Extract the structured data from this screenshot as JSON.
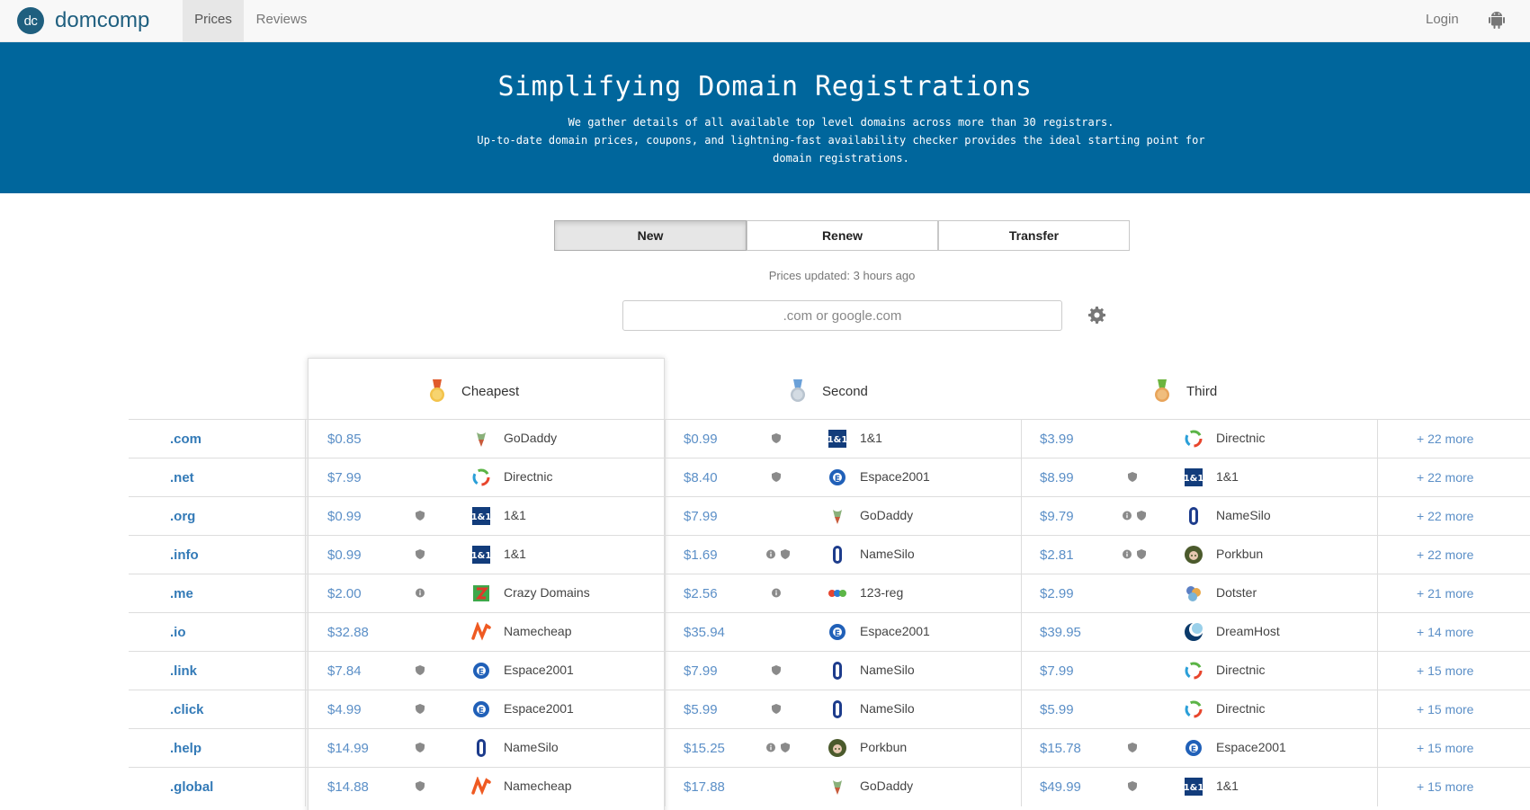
{
  "nav": {
    "logo": "dc",
    "brand": "domcomp",
    "tabs": [
      "Prices",
      "Reviews"
    ],
    "login": "Login"
  },
  "hero": {
    "title": "Simplifying Domain Registrations",
    "line1": "We gather details of all available top level domains across more than 30 registrars.",
    "line2": "Up-to-date domain prices, coupons, and lightning-fast availability checker provides the ideal starting point for domain registrations."
  },
  "toggle": {
    "new": "New",
    "renew": "Renew",
    "transfer": "Transfer",
    "selected": "New"
  },
  "updated": "Prices updated: 3 hours ago",
  "search": {
    "placeholder": ".com or google.com"
  },
  "headers": {
    "cheapest": "Cheapest",
    "second": "Second",
    "third": "Third"
  },
  "colors": {
    "hero": "#00669c",
    "link": "#337ab7",
    "price": "#5b8fc7"
  },
  "rows": [
    {
      "tld": ".com",
      "c": [
        "$0.85",
        [],
        "GoDaddy",
        "godaddy"
      ],
      "s": [
        "$0.99",
        [
          "shield"
        ],
        "1&1",
        "oneandone"
      ],
      "t": [
        "$3.99",
        [],
        "Directnic",
        "directnic"
      ],
      "more": "+ 22 more"
    },
    {
      "tld": ".net",
      "c": [
        "$7.99",
        [],
        "Directnic",
        "directnic"
      ],
      "s": [
        "$8.40",
        [
          "shield"
        ],
        "Espace2001",
        "espace"
      ],
      "t": [
        "$8.99",
        [
          "shield"
        ],
        "1&1",
        "oneandone"
      ],
      "more": "+ 22 more"
    },
    {
      "tld": ".org",
      "c": [
        "$0.99",
        [
          "shield"
        ],
        "1&1",
        "oneandone"
      ],
      "s": [
        "$7.99",
        [],
        "GoDaddy",
        "godaddy"
      ],
      "t": [
        "$9.79",
        [
          "info",
          "shield"
        ],
        "NameSilo",
        "namesilo"
      ],
      "more": "+ 22 more"
    },
    {
      "tld": ".info",
      "c": [
        "$0.99",
        [
          "shield"
        ],
        "1&1",
        "oneandone"
      ],
      "s": [
        "$1.69",
        [
          "info",
          "shield"
        ],
        "NameSilo",
        "namesilo"
      ],
      "t": [
        "$2.81",
        [
          "info",
          "shield"
        ],
        "Porkbun",
        "porkbun"
      ],
      "more": "+ 22 more"
    },
    {
      "tld": ".me",
      "c": [
        "$2.00",
        [
          "info"
        ],
        "Crazy Domains",
        "crazy"
      ],
      "s": [
        "$2.56",
        [
          "info"
        ],
        "123-reg",
        "reg123"
      ],
      "t": [
        "$2.99",
        [],
        "Dotster",
        "dotster"
      ],
      "more": "+ 21 more"
    },
    {
      "tld": ".io",
      "c": [
        "$32.88",
        [],
        "Namecheap",
        "namecheap"
      ],
      "s": [
        "$35.94",
        [],
        "Espace2001",
        "espace"
      ],
      "t": [
        "$39.95",
        [],
        "DreamHost",
        "dreamhost"
      ],
      "more": "+ 14 more"
    },
    {
      "tld": ".link",
      "c": [
        "$7.84",
        [
          "shield"
        ],
        "Espace2001",
        "espace"
      ],
      "s": [
        "$7.99",
        [
          "shield"
        ],
        "NameSilo",
        "namesilo"
      ],
      "t": [
        "$7.99",
        [],
        "Directnic",
        "directnic"
      ],
      "more": "+ 15 more"
    },
    {
      "tld": ".click",
      "c": [
        "$4.99",
        [
          "shield"
        ],
        "Espace2001",
        "espace"
      ],
      "s": [
        "$5.99",
        [
          "shield"
        ],
        "NameSilo",
        "namesilo"
      ],
      "t": [
        "$5.99",
        [],
        "Directnic",
        "directnic"
      ],
      "more": "+ 15 more"
    },
    {
      "tld": ".help",
      "c": [
        "$14.99",
        [
          "shield"
        ],
        "NameSilo",
        "namesilo"
      ],
      "s": [
        "$15.25",
        [
          "info",
          "shield"
        ],
        "Porkbun",
        "porkbun"
      ],
      "t": [
        "$15.78",
        [
          "shield"
        ],
        "Espace2001",
        "espace"
      ],
      "more": "+ 15 more"
    },
    {
      "tld": ".global",
      "c": [
        "$14.88",
        [
          "shield"
        ],
        "Namecheap",
        "namecheap"
      ],
      "s": [
        "$17.88",
        [],
        "GoDaddy",
        "godaddy"
      ],
      "t": [
        "$49.99",
        [
          "shield"
        ],
        "1&1",
        "oneandone"
      ],
      "more": "+ 15 more"
    }
  ]
}
